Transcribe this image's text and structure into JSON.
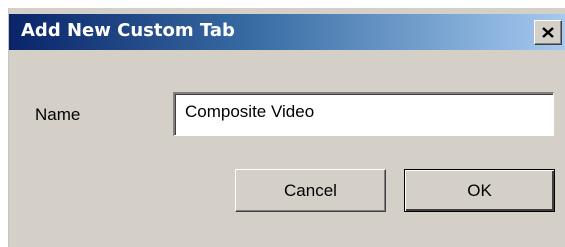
{
  "window": {
    "title": "Add New Custom Tab",
    "close_label": "X"
  },
  "form": {
    "name_label": "Name",
    "name_value": "Composite Video"
  },
  "buttons": {
    "cancel_label": "Cancel",
    "ok_label": "OK"
  },
  "colors": {
    "titlebar_start": "#0a246a",
    "titlebar_end": "#a6caf0",
    "dialog_background": "#d4d0c8"
  },
  "icons": {
    "close": "close-icon"
  }
}
